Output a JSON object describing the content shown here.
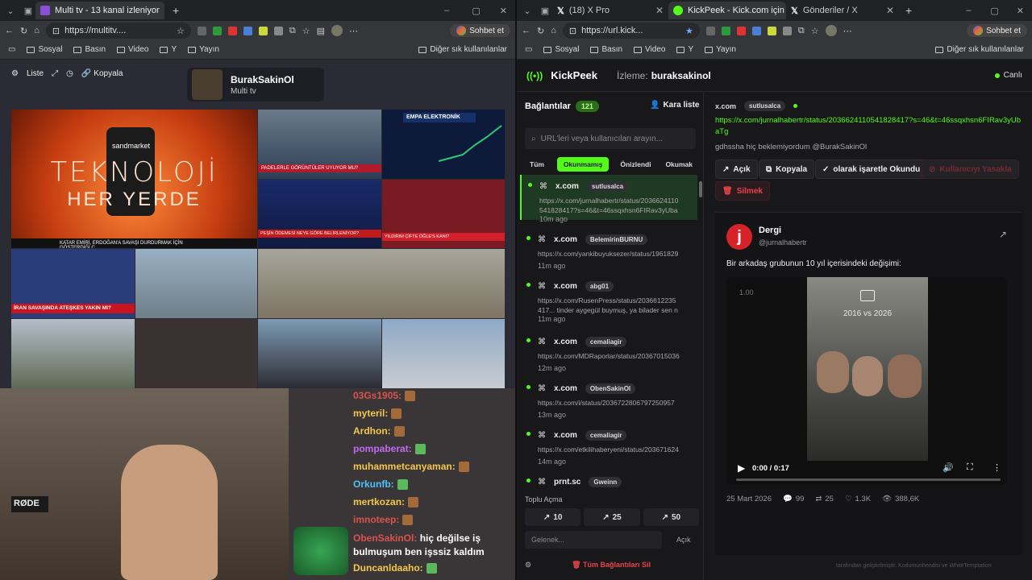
{
  "left_browser": {
    "tab_title": "Multi tv - 13 kanal izleniyor",
    "url": "https://multitv....",
    "copilot_label": "Sohbet et",
    "bookmarks": [
      "Sosyal",
      "Basın",
      "Video",
      "Y",
      "Yayın"
    ],
    "other_bookmarks": "Diğer sık kullanılanlar"
  },
  "right_browser": {
    "tabs": [
      "(18) X Pro",
      "KickPeek - Kick.com için G",
      "Gönderiler / X"
    ],
    "url": "https://url.kick...",
    "copilot_label": "Sohbet et",
    "bookmarks": [
      "Sosyal",
      "Basın",
      "Video",
      "Y",
      "Yayın"
    ],
    "other_bookmarks": "Diğer sık kullanılanlar"
  },
  "multitv": {
    "toolbar": {
      "list_label": "Liste",
      "copy_label": "Kopyala"
    },
    "channel_name": "BurakSakinOl",
    "channel_sub": "Multi tv",
    "tiles": {
      "main_title": "TEKNOLOJİ",
      "main_sub": "HER YERDE",
      "brand": "sandmarket",
      "ticker_main": "KATAR EMİRİ, ERDOĞAN'A SAVAŞI DURDURMAK İÇİN GÖSTERDİĞİ Ç",
      "ticker_a": "PADELERLE GÖRÜNTÜLER UYUYOR MU?",
      "ticker_b": "EMPA ELEKTRONİK",
      "ticker_c": "PEŞİN ÖDEMESİ NEYE GÖRE BELİRLENİYOR?",
      "ticker_d": "YILDIRIM ÇİFTE ÖĞLE'S KANI?",
      "ticker_e": "İRAN SAVAŞINDA ATEŞKES YAKIN MI?"
    }
  },
  "chat": {
    "messages": [
      {
        "user": "03Gs1905:",
        "color": "#d9534f",
        "text": ""
      },
      {
        "user": "myteril:",
        "color": "#f2c94c",
        "text": ""
      },
      {
        "user": "Ardhon:",
        "color": "#f2c94c",
        "text": ""
      },
      {
        "user": "pompaberat:",
        "color": "#c36bf0",
        "text": ""
      },
      {
        "user": "muhammetcanyaman:",
        "color": "#f2c94c",
        "text": ""
      },
      {
        "user": "Orkunfb:",
        "color": "#4fc3f7",
        "text": ""
      },
      {
        "user": "mertkozan:",
        "color": "#f2c94c",
        "text": ""
      },
      {
        "user": "imnoteep:",
        "color": "#d9534f",
        "text": ""
      },
      {
        "user": "ObenSakinOl:",
        "color": "#d9534f",
        "text": "hiç değilse iş bulmuşum ben işssiz kaldım"
      },
      {
        "user": "Duncanldaaho:",
        "color": "#f2c94c",
        "text": ""
      }
    ],
    "mic_brand": "RØDE"
  },
  "kickpeek": {
    "app_name": "KickPeek",
    "watching_label": "İzleme:",
    "watching_user": "buraksakinol",
    "status": "Canlı",
    "connections_label": "Bağlantılar",
    "connections_count": "121",
    "blacklist_label": "Kara liste",
    "search_placeholder": "URL'leri veya kullanıcıları arayın...",
    "filters": [
      "Tüm",
      "Okunmamış",
      "Önizlendi",
      "Okumak"
    ],
    "active_filter": "Okunmamış",
    "items": [
      {
        "source": "x.com",
        "user": "sutlusalca",
        "url": "https://x.com/jurnalhabertr/status/2036624110541828417?s=46&t=46ssqxhsn6FIRav3yUbaTg gdhssha hi...",
        "time": "10m ago"
      },
      {
        "source": "x.com",
        "user": "BelemirinBURNU",
        "url": "https://x.com/yankibuyuksezer/status/19618299",
        "time": "11m ago"
      },
      {
        "source": "x.com",
        "user": "abg01",
        "url": "https://x.com/RusenPress/status/2036612235417... tinder aygegül buymuş, ya bilader sen nasıl bi...",
        "time": "11m ago"
      },
      {
        "source": "x.com",
        "user": "cemaliagir",
        "url": "https://x.com/MDRaporlar/status/203670150368",
        "time": "12m ago"
      },
      {
        "source": "x.com",
        "user": "ObenSakinOl",
        "url": "https://x.com/i/status/2036722806797250957",
        "time": "13m ago"
      },
      {
        "source": "x.com",
        "user": "cemaliagir",
        "url": "https://x.com/etkilihaberyeni/status/203671624",
        "time": "14m ago"
      },
      {
        "source": "prnt.sc",
        "user": "Gweinn",
        "url": "",
        "time": ""
      }
    ],
    "bulk_open_label": "Toplu Açma",
    "bulk_buttons": [
      "10",
      "25",
      "50"
    ],
    "next_placeholder": "Gelenek...",
    "open_label": "Açık",
    "delete_all_label": "Tüm Bağlantıları Sil",
    "detail": {
      "source": "x.com",
      "user": "sutlusalca",
      "url": "https://x.com/jurnalhabertr/status/2036624110541828417?s=46&t=46ssqxhsn6FIRav3yUbaTg",
      "message": "gdhssha hiç beklemiyordum @BurakSakinOl",
      "actions": {
        "open": "Açık",
        "copy": "Kopyala",
        "mark_read": "olarak işaretle Okundu",
        "ban_user": "Kullanıcıyı Yasakla",
        "delete": "Silmek"
      }
    },
    "tweet": {
      "author": "Dergi",
      "handle": "@jurnalhabertr",
      "text": "Bir arkadaş grubunun 10 yıl içerisindeki değişimi:",
      "speed": "1.00",
      "video_caption": "2016 vs 2026",
      "time": "0:00 / 0:17",
      "progress": 0.0,
      "date": "25 Mart 2026",
      "replies": "99",
      "retweets": "25",
      "likes": "1.3K",
      "views": "388,6K"
    },
    "footer": "tarafından geliştirilmiştir. Kodumunhendisi ve WhiteTemptation"
  }
}
